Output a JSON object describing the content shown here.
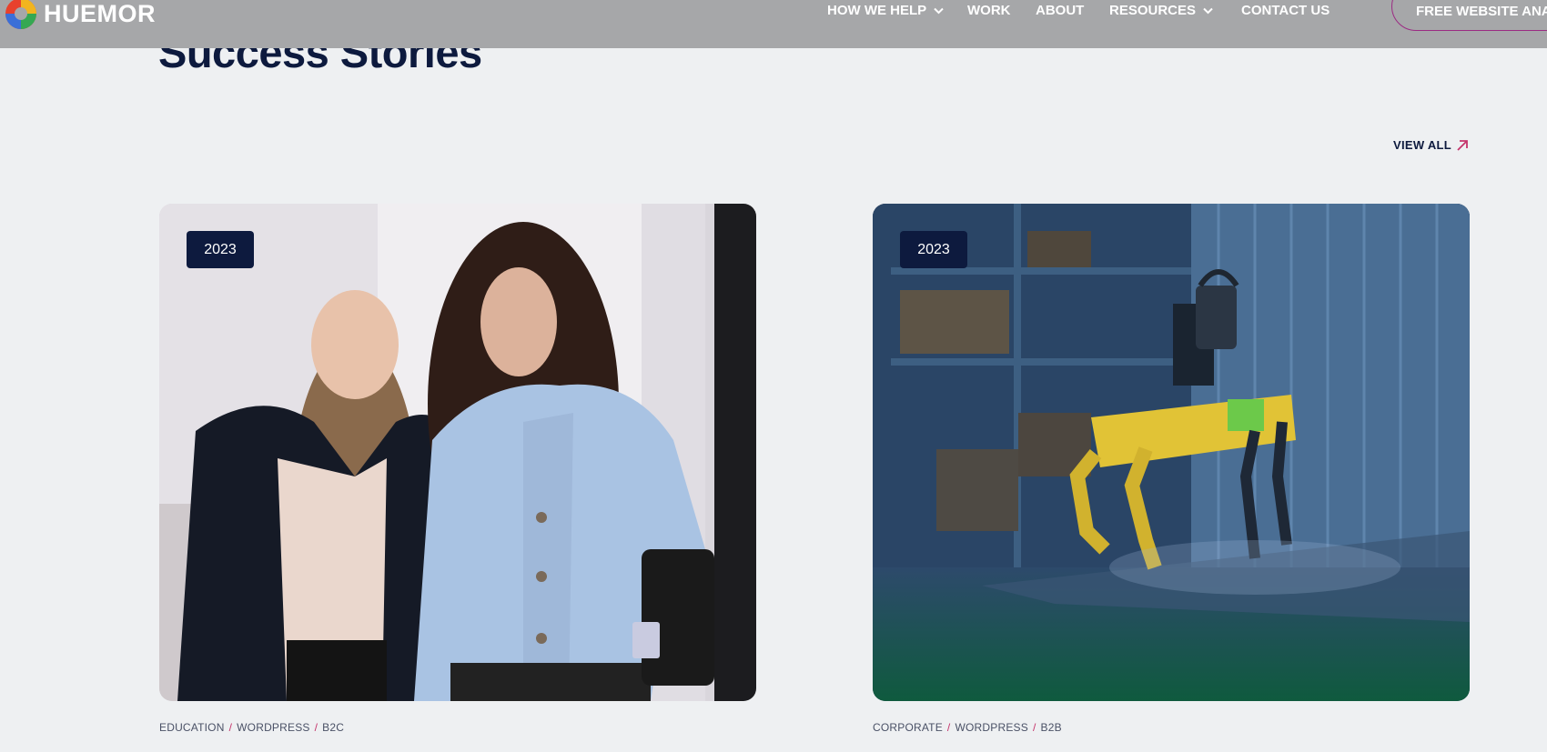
{
  "header": {
    "brand": "HUEMOR",
    "nav": [
      {
        "label": "HOW WE HELP",
        "has_menu": true
      },
      {
        "label": "WORK",
        "has_menu": false
      },
      {
        "label": "ABOUT",
        "has_menu": false
      },
      {
        "label": "RESOURCES",
        "has_menu": true
      },
      {
        "label": "CONTACT US",
        "has_menu": false
      }
    ],
    "cta_label": "FREE WEBSITE ANAL"
  },
  "section": {
    "title": "Success Stories",
    "view_all_label": "VIEW ALL",
    "tag_separator": "/"
  },
  "cards": [
    {
      "year": "2023",
      "tags": [
        "EDUCATION",
        "WORDPRESS",
        "B2C"
      ],
      "image": "two-women-in-hallway-photo"
    },
    {
      "year": "2023",
      "tags": [
        "CORPORATE",
        "WORDPRESS",
        "B2B"
      ],
      "image": "yellow-robot-dog-in-warehouse-photo"
    }
  ],
  "colors": {
    "page_bg": "#eef0f2",
    "header_bg": "#a6a7a9",
    "navy": "#0d1a3e",
    "accent_pink": "#c5346b",
    "cta_border": "#9b2b83"
  },
  "icons": {
    "logo": "huemor-color-wheel-icon",
    "nav_dropdown": "chevron-down-icon",
    "view_all": "arrow-up-right-icon"
  }
}
